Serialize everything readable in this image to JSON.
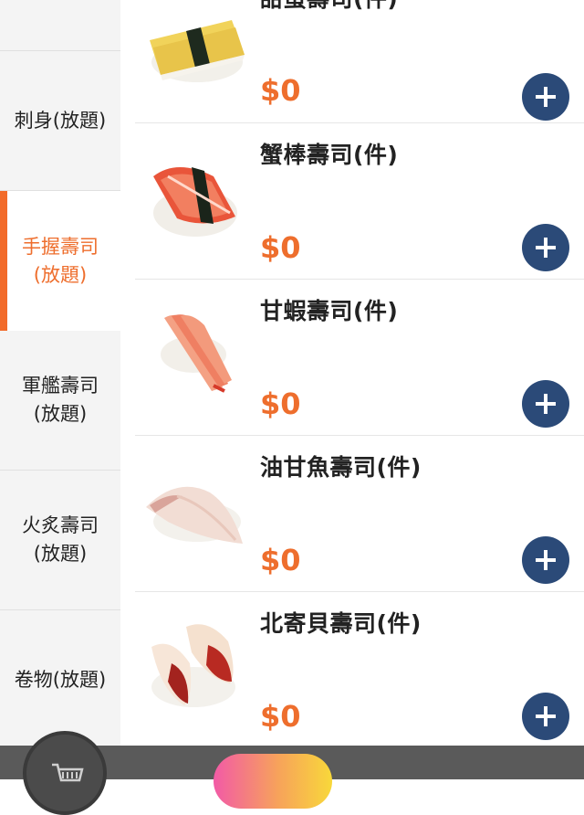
{
  "sidebar": {
    "items": [
      {
        "label": ""
      },
      {
        "label": "刺身(放題)"
      },
      {
        "label": "手握壽司\n(放題)",
        "active": true
      },
      {
        "label": "軍艦壽司\n(放題)"
      },
      {
        "label": "火炙壽司\n(放題)"
      },
      {
        "label": "卷物(放題)"
      }
    ]
  },
  "products": [
    {
      "name": "甜蛋壽司(件)",
      "price": "$0",
      "icon": "tamago-sushi-image"
    },
    {
      "name": "蟹棒壽司(件)",
      "price": "$0",
      "icon": "crab-stick-sushi-image"
    },
    {
      "name": "甘蝦壽司(件)",
      "price": "$0",
      "icon": "sweet-shrimp-sushi-image"
    },
    {
      "name": "油甘魚壽司(件)",
      "price": "$0",
      "icon": "yellowtail-sushi-image"
    },
    {
      "name": "北寄貝壽司(件)",
      "price": "$0",
      "icon": "surf-clam-sushi-image"
    }
  ],
  "bottom_bar": {
    "cart_icon": "cart-icon",
    "checkout_label": "",
    "total_label": ""
  },
  "colors": {
    "accent": "#ee6e2d",
    "button": "#2b4a78",
    "sidebar_bg": "#f4f4f4"
  }
}
